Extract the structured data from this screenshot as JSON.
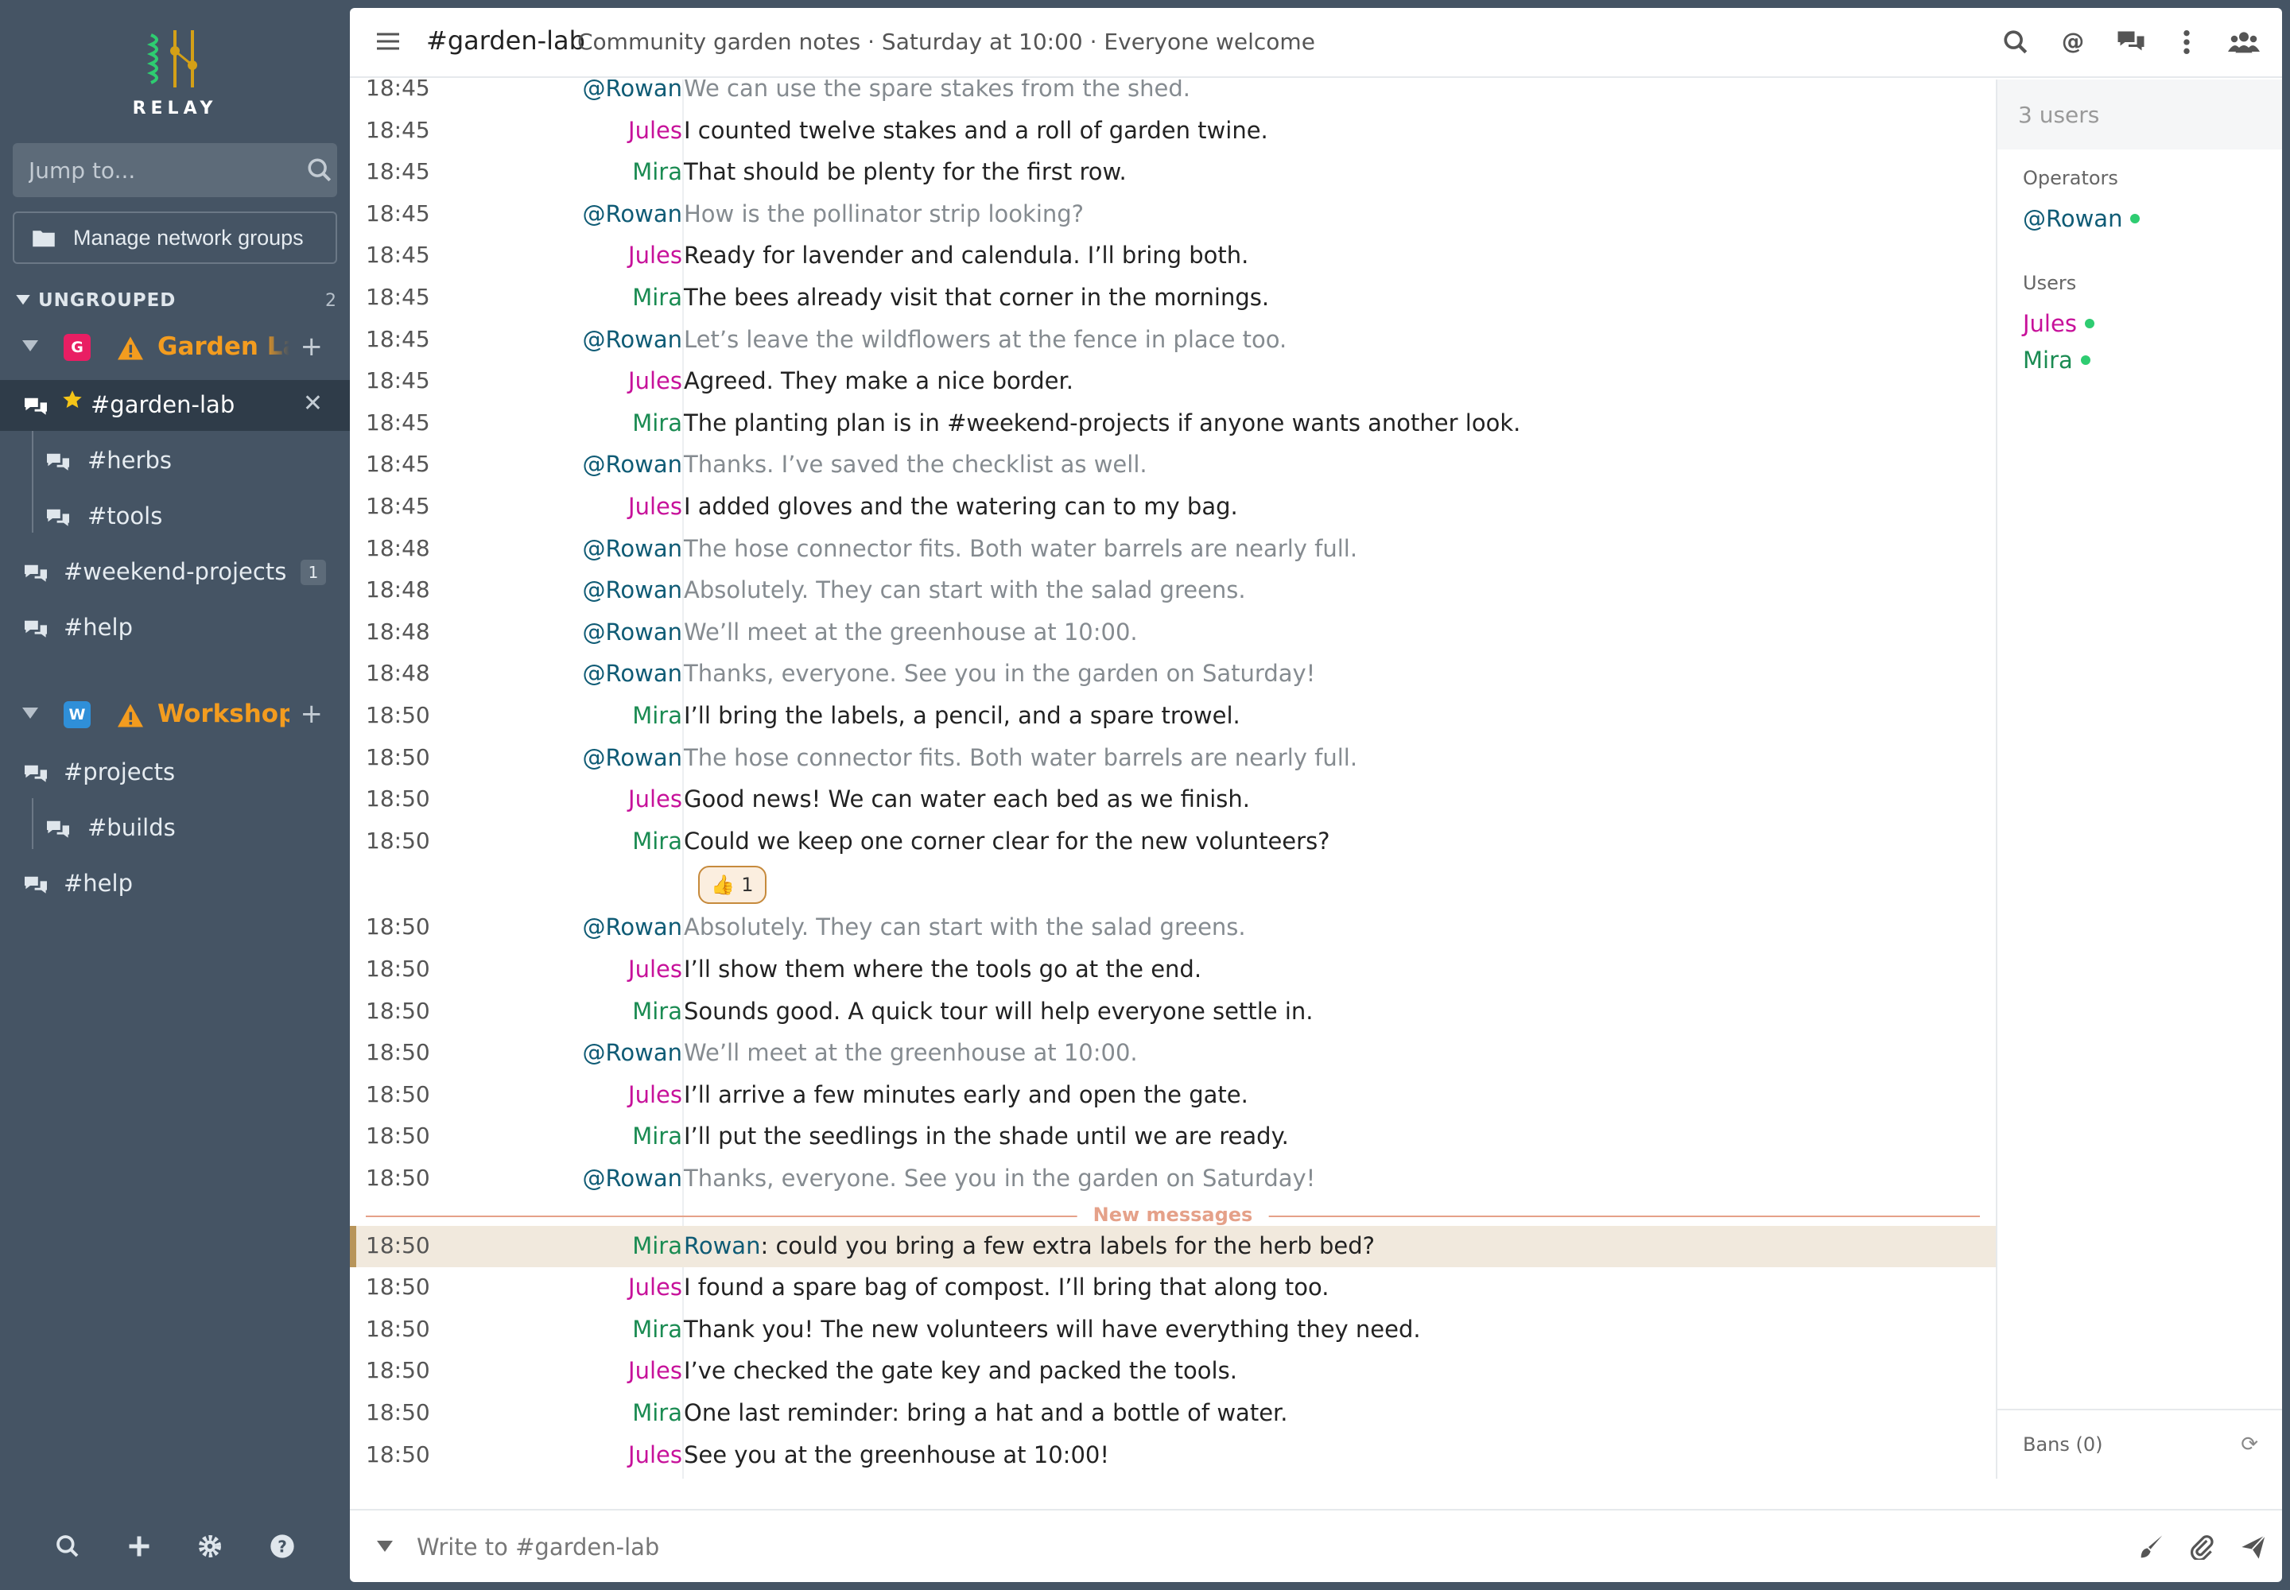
{
  "app": {
    "logo_text": "RELAY",
    "jump_placeholder": "Jump to...",
    "manage_label": "Manage network groups"
  },
  "sidebar": {
    "category": {
      "label": "UNGROUPED",
      "count": "2"
    },
    "networks": [
      {
        "name": "Garden Lab",
        "badge": "G",
        "badge_color": "#e91e63",
        "channels": [
          {
            "name": "#garden-lab",
            "active": true,
            "starred": true
          },
          {
            "name": "#herbs",
            "sub": true
          },
          {
            "name": "#tools",
            "sub": true
          },
          {
            "name": "#weekend-projects",
            "unread": "1"
          },
          {
            "name": "#help"
          }
        ]
      },
      {
        "name": "Workshop",
        "badge": "W",
        "badge_color": "#2f8fd8",
        "channels": [
          {
            "name": "#projects"
          },
          {
            "name": "#builds",
            "sub": true
          },
          {
            "name": "#help"
          }
        ]
      }
    ]
  },
  "header": {
    "channel": "#garden-lab",
    "topic": "Community garden notes · Saturday at 10:00 · Everyone welcome"
  },
  "messages": [
    {
      "time": "18:45",
      "user": "@Rowan",
      "text": "We can use the spare stakes from the shed."
    },
    {
      "time": "18:45",
      "user": "Jules",
      "text": "I counted twelve stakes and a roll of garden twine."
    },
    {
      "time": "18:45",
      "user": "Mira",
      "text": "That should be plenty for the first row."
    },
    {
      "time": "18:45",
      "user": "@Rowan",
      "text": "How is the pollinator strip looking?"
    },
    {
      "time": "18:45",
      "user": "Jules",
      "text": "Ready for lavender and calendula. I’ll bring both."
    },
    {
      "time": "18:45",
      "user": "Mira",
      "text": "The bees already visit that corner in the mornings."
    },
    {
      "time": "18:45",
      "user": "@Rowan",
      "text": "Let’s leave the wildflowers at the fence in place too."
    },
    {
      "time": "18:45",
      "user": "Jules",
      "text": "Agreed. They make a nice border."
    },
    {
      "time": "18:45",
      "user": "Mira",
      "text": "The planting plan is in #weekend-projects if anyone wants another look."
    },
    {
      "time": "18:45",
      "user": "@Rowan",
      "text": "Thanks. I’ve saved the checklist as well."
    },
    {
      "time": "18:45",
      "user": "Jules",
      "text": "I added gloves and the watering can to my bag."
    },
    {
      "time": "18:48",
      "user": "@Rowan",
      "text": "The hose connector fits. Both water barrels are nearly full."
    },
    {
      "time": "18:48",
      "user": "@Rowan",
      "text": "Absolutely. They can start with the salad greens."
    },
    {
      "time": "18:48",
      "user": "@Rowan",
      "text": "We’ll meet at the greenhouse at 10:00."
    },
    {
      "time": "18:48",
      "user": "@Rowan",
      "text": "Thanks, everyone. See you in the garden on Saturday!"
    },
    {
      "time": "18:50",
      "user": "Mira",
      "text": "I’ll bring the labels, a pencil, and a spare trowel."
    },
    {
      "time": "18:50",
      "user": "@Rowan",
      "text": "The hose connector fits. Both water barrels are nearly full."
    },
    {
      "time": "18:50",
      "user": "Jules",
      "text": "Good news! We can water each bed as we finish."
    },
    {
      "time": "18:50",
      "user": "Mira",
      "text": "Could we keep one corner clear for the new volunteers?"
    },
    {
      "time": "18:50",
      "user": "@Rowan",
      "text": "Absolutely. They can start with the salad greens."
    },
    {
      "time": "18:50",
      "user": "Jules",
      "text": "I’ll show them where the tools go at the end."
    },
    {
      "time": "18:50",
      "user": "Mira",
      "text": "Sounds good. A quick tour will help everyone settle in."
    },
    {
      "time": "18:50",
      "user": "@Rowan",
      "text": "We’ll meet at the greenhouse at 10:00."
    },
    {
      "time": "18:50",
      "user": "Jules",
      "text": "I’ll arrive a few minutes early and open the gate."
    },
    {
      "time": "18:50",
      "user": "Mira",
      "text": "I’ll put the seedlings in the shade until we are ready."
    },
    {
      "time": "18:50",
      "user": "@Rowan",
      "text": "Thanks, everyone. See you in the garden on Saturday!"
    },
    {
      "time": "18:50",
      "user": "Mira",
      "mention": "Rowan",
      "text": ": could you bring a few extra labels for the herb bed?",
      "highlight": true
    },
    {
      "time": "18:50",
      "user": "Jules",
      "text": "I found a spare bag of compost. I’ll bring that along too."
    },
    {
      "time": "18:50",
      "user": "Mira",
      "text": "Thank you! The new volunteers will have everything they need."
    },
    {
      "time": "18:50",
      "user": "Jules",
      "text": "I’ve checked the gate key and packed the tools."
    },
    {
      "time": "18:50",
      "user": "Mira",
      "text": "One last reminder: bring a hat and a bottle of water."
    },
    {
      "time": "18:50",
      "user": "Jules",
      "text": "See you at the greenhouse at 10:00!"
    }
  ],
  "reaction": {
    "emoji": "👍",
    "count": "1"
  },
  "new_messages_label": "New messages",
  "userlist": {
    "search_placeholder": "3 users",
    "operators_label": "Operators",
    "operators": [
      "@Rowan"
    ],
    "users_label": "Users",
    "users": [
      "Jules",
      "Mira"
    ],
    "bans_label": "Bans (0)"
  },
  "composer": {
    "placeholder": "Write to #garden-lab"
  },
  "colors": {
    "sidebar_bg": "#455464",
    "active_channel_bg": "#2f3c49",
    "network_name": "#f39c1f",
    "rowan": "#0f5b75",
    "jules": "#c7119a",
    "mira": "#1a8b52",
    "online": "#2ecc71",
    "new_messages": "#e5a189",
    "highlight_bg": "#f1e9dd"
  }
}
